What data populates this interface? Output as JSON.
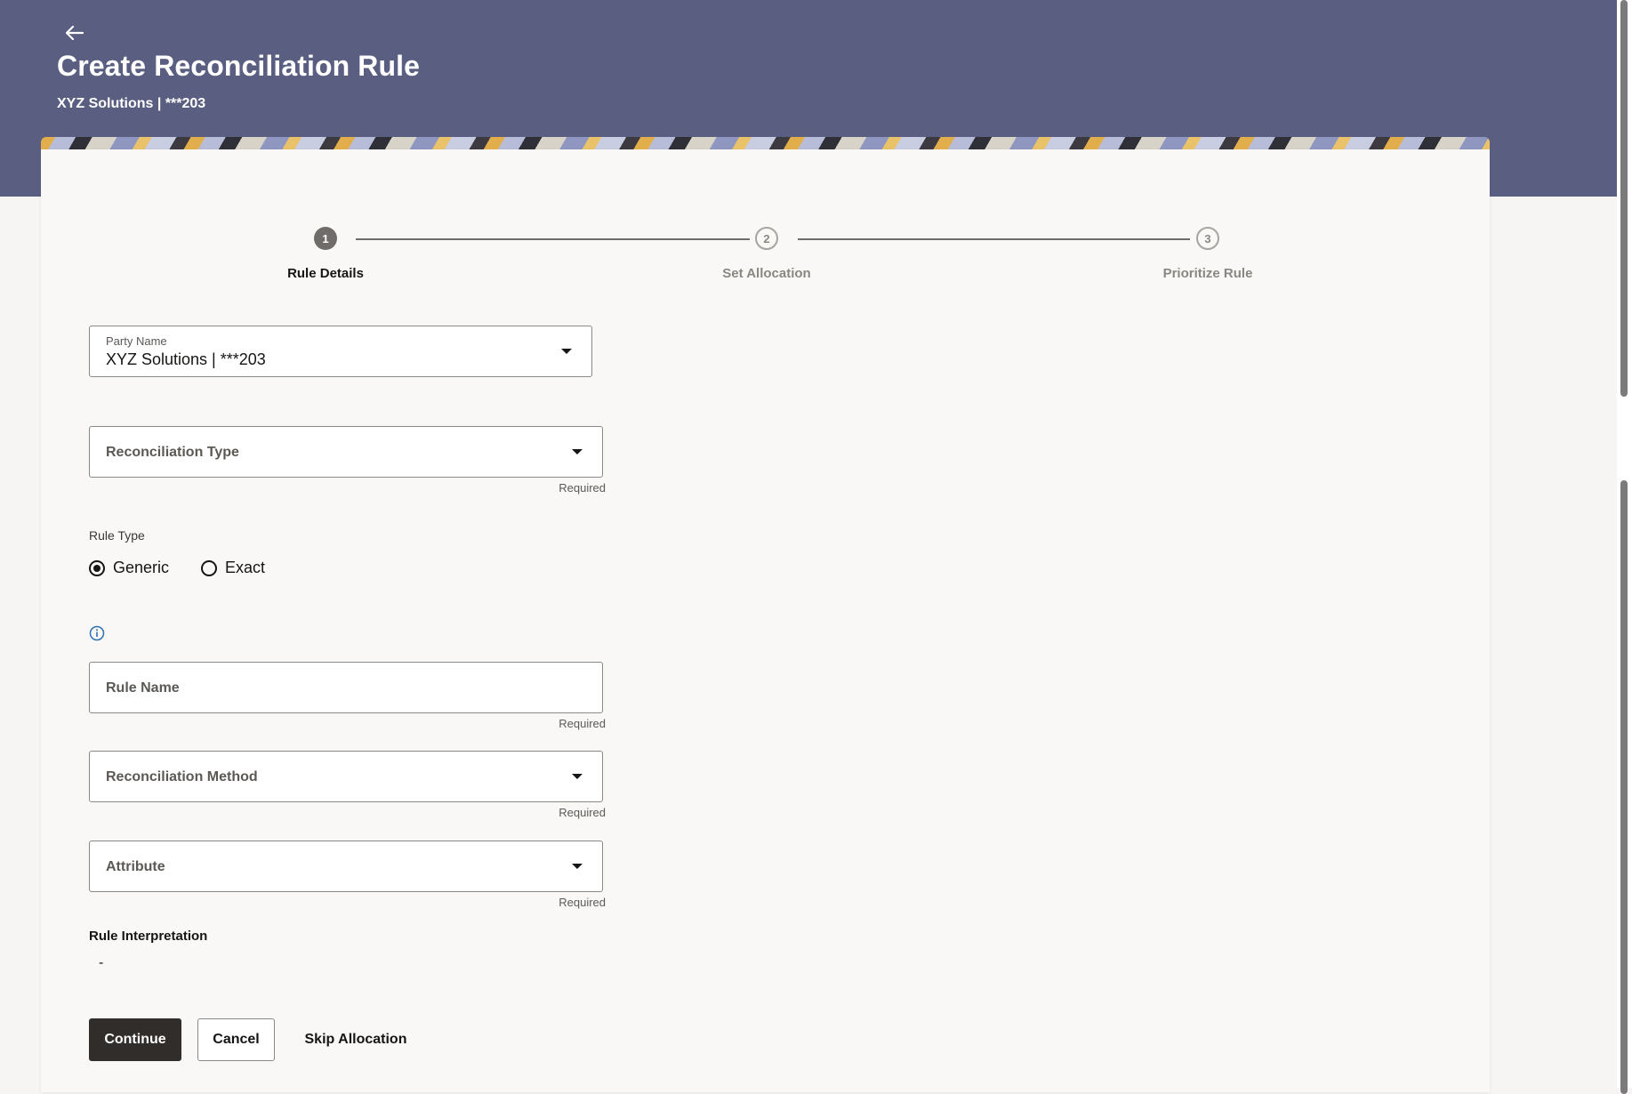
{
  "header": {
    "title": "Create Reconciliation Rule",
    "subtitle": "XYZ Solutions | ***203",
    "back_icon": "arrow-left-icon"
  },
  "stepper": {
    "steps": [
      {
        "number": "1",
        "label": "Rule Details",
        "state": "active"
      },
      {
        "number": "2",
        "label": "Set Allocation",
        "state": "inactive"
      },
      {
        "number": "3",
        "label": "Prioritize Rule",
        "state": "inactive"
      }
    ]
  },
  "form": {
    "party_name": {
      "label": "Party Name",
      "value": "XYZ Solutions | ***203"
    },
    "reconciliation_type": {
      "placeholder": "Reconciliation Type",
      "required": "Required"
    },
    "rule_type": {
      "label": "Rule Type",
      "options": [
        {
          "label": "Generic",
          "selected": true
        },
        {
          "label": "Exact",
          "selected": false
        }
      ]
    },
    "rule_name": {
      "placeholder": "Rule Name",
      "required": "Required"
    },
    "reconciliation_method": {
      "placeholder": "Reconciliation Method",
      "required": "Required"
    },
    "attribute": {
      "placeholder": "Attribute",
      "required": "Required"
    },
    "rule_interpretation": {
      "label": "Rule Interpretation",
      "value": "-"
    }
  },
  "actions": {
    "continue_label": "Continue",
    "cancel_label": "Cancel",
    "skip_label": "Skip Allocation"
  },
  "colors": {
    "header_bg": "#5a5f82",
    "primary_button": "#312d2a",
    "info_icon": "#2f6fb3"
  }
}
